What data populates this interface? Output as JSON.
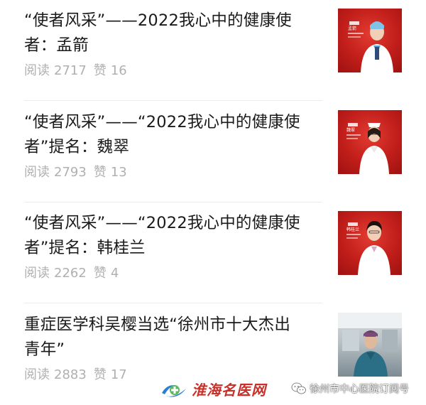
{
  "articles": [
    {
      "title_line1": "“使者风采”——2022我心中的健康使",
      "title_line2": "者：孟箭",
      "reads_label": "阅读",
      "reads": "2717",
      "likes_label": "赞",
      "likes": "16",
      "thumb_caption": "孟箭"
    },
    {
      "title_line1": "“使者风采”——“2022我心中的健康使",
      "title_line2": "者”提名：魏翠",
      "reads_label": "阅读",
      "reads": "2793",
      "likes_label": "赞",
      "likes": "13",
      "thumb_caption": "魏翠"
    },
    {
      "title_line1": "“使者风采”——“2022我心中的健康使",
      "title_line2": "者”提名：韩桂兰",
      "reads_label": "阅读",
      "reads": "2262",
      "likes_label": "赞",
      "likes": "4",
      "thumb_caption": "韩桂兰"
    },
    {
      "title_line1": "重症医学科吴樱当选“徐州市十大杰出",
      "title_line2": "青年”",
      "reads_label": "阅读",
      "reads": "2883",
      "likes_label": "赞",
      "likes": "17"
    }
  ],
  "footer": {
    "brand_name": "淮海名医网",
    "account_name": "徐州市中心医院订阅号"
  },
  "colors": {
    "title": "#1a1a1a",
    "meta": "#b0b0b0",
    "thumb_red": "#c11e1a",
    "brand_red": "#c8302a",
    "brand_blue": "#2a7fd4"
  }
}
